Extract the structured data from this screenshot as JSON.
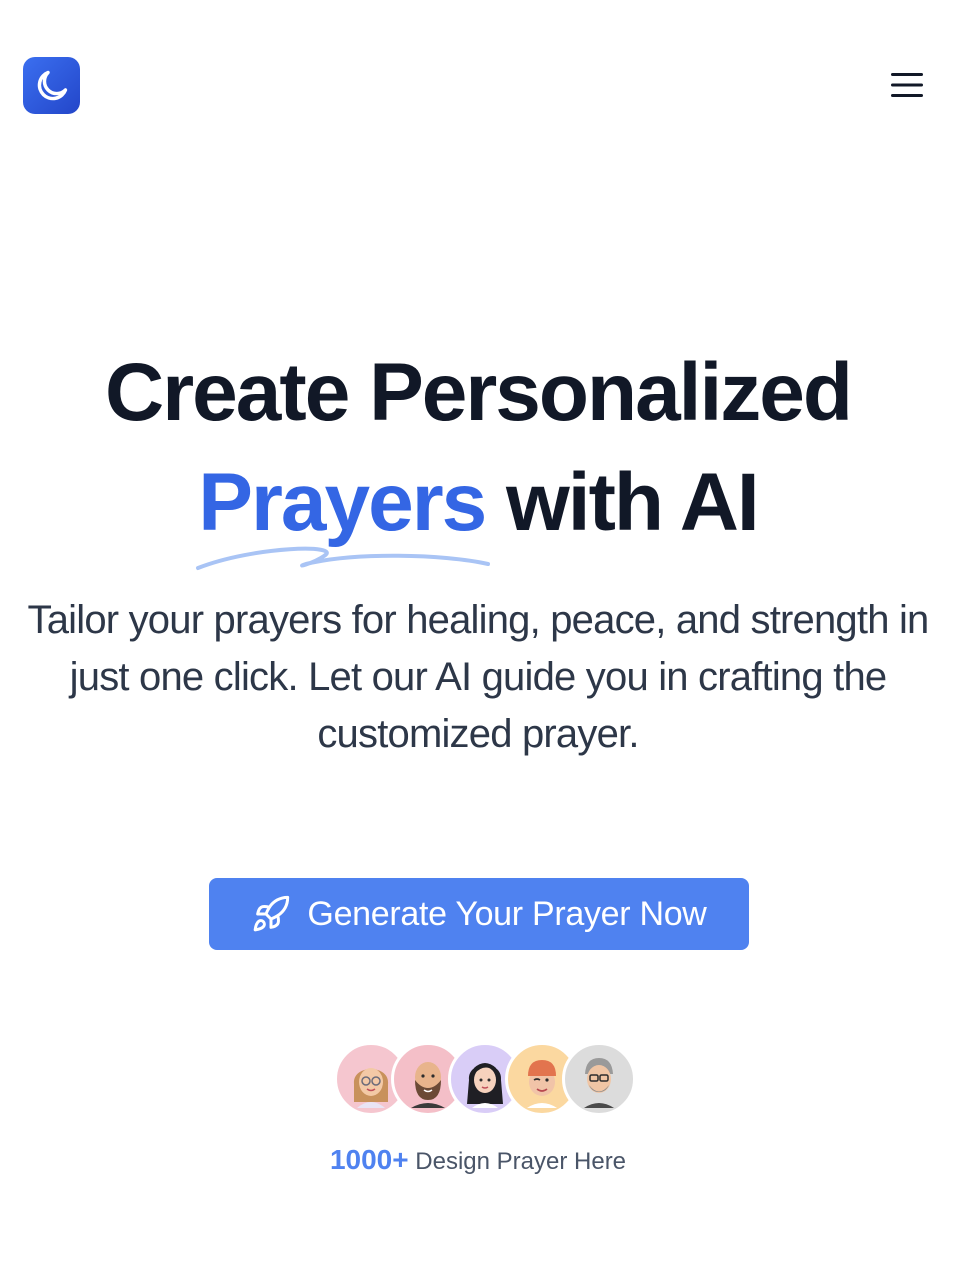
{
  "header": {
    "logo_icon": "moon-icon",
    "menu_icon": "hamburger-menu-icon"
  },
  "hero": {
    "title_line1": "Create Personalized",
    "title_highlight": "Prayers",
    "title_rest": "with AI",
    "subtitle": "Tailor your prayers for healing, peace, and strength in just one click. Let our AI guide you in crafting the customized prayer.",
    "cta_label": "Generate Your Prayer Now",
    "cta_icon": "rocket-icon"
  },
  "social_proof": {
    "avatars": [
      {
        "icon": "avatar-woman-glasses",
        "bg": "#f5c6cf"
      },
      {
        "icon": "avatar-bald-beard-man",
        "bg": "#f4bfc8"
      },
      {
        "icon": "avatar-woman-dark-hair",
        "bg": "#d9cdf7"
      },
      {
        "icon": "avatar-winking-man-beanie",
        "bg": "#fbd8a0"
      },
      {
        "icon": "avatar-gray-hair-glasses-man",
        "bg": "#dcdcdc"
      }
    ],
    "count": "1000+",
    "text": "Design Prayer Here"
  },
  "colors": {
    "accent": "#4f82f0",
    "highlight": "#3466e4",
    "heading": "#111827",
    "body_text": "#2d3748"
  }
}
